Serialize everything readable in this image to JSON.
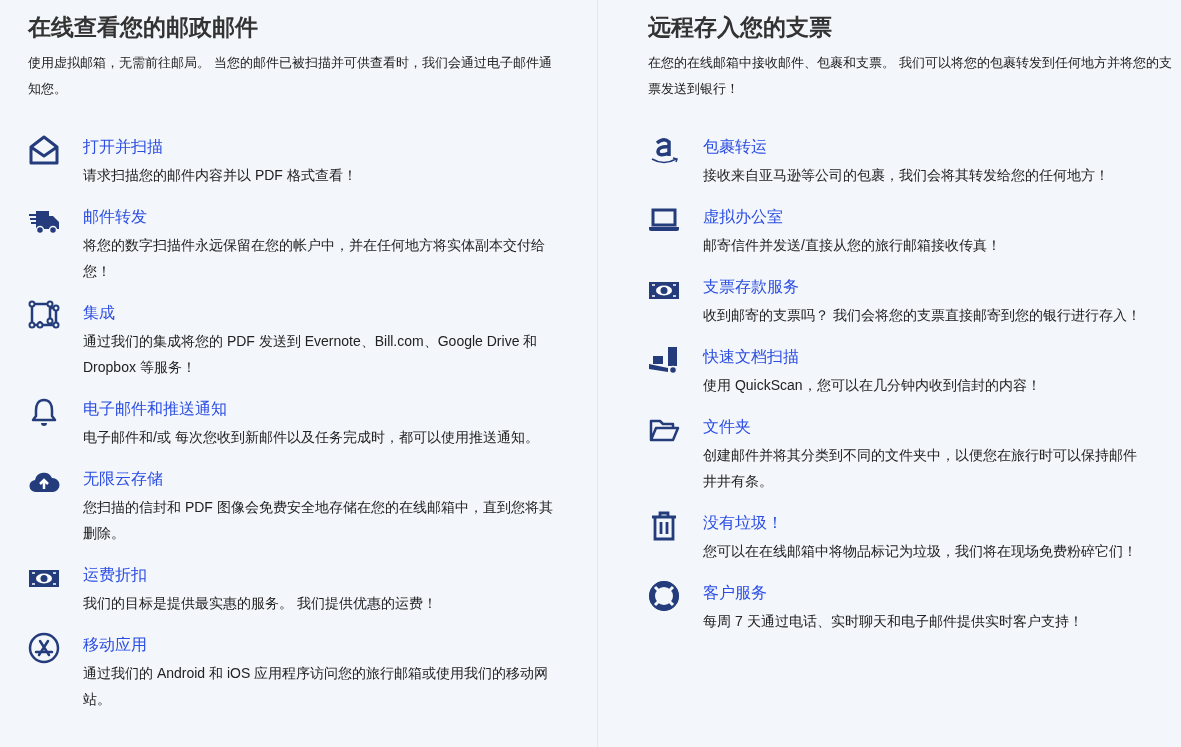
{
  "sections": [
    {
      "heading": "在线查看您的邮政邮件",
      "intro": "使用虚拟邮箱，无需前往邮局。 当您的邮件已被扫描并可供查看时，我们会通过电子邮件通知您。",
      "features": [
        {
          "title": "打开并扫描",
          "description": "请求扫描您的邮件内容并以 PDF 格式查看！"
        },
        {
          "title": "邮件转发",
          "description": "将您的数字扫描件永远保留在您的帐户中，并在任何地方将实体副本交付给您！"
        },
        {
          "title": "集成",
          "description": "通过我们的集成将您的 PDF 发送到 Evernote、Bill.com、Google Drive 和 Dropbox 等服务！"
        },
        {
          "title": "电子邮件和推送通知",
          "description": "电子邮件和/或 每次您收到新邮件以及任务完成时，都可以使用推送通知。"
        },
        {
          "title": "无限云存储",
          "description": "您扫描的信封和 PDF 图像会免费安全地存储在您的在线邮箱中，直到您将其删除。"
        },
        {
          "title": "运费折扣",
          "description": "我们的目标是提供最实惠的服务。 我们提供优惠的运费！"
        },
        {
          "title": "移动应用",
          "description": "通过我们的 Android 和 iOS 应用程序访问您的旅行邮箱或使用我们的移动网站。"
        }
      ]
    },
    {
      "heading": "远程存入您的支票",
      "intro": "在您的在线邮箱中接收邮件、包裹和支票。 我们可以将您的包裹转发到任何地方并将您的支票发送到银行！",
      "features": [
        {
          "title": "包裹转运",
          "description": "接收来自亚马逊等公司的包裹，我们会将其转发给您的任何地方！"
        },
        {
          "title": "虚拟办公室",
          "description": "邮寄信件并发送/直接从您的旅行邮箱接收传真！"
        },
        {
          "title": "支票存款服务",
          "description": "收到邮寄的支票吗？ 我们会将您的支票直接邮寄到您的银行进行存入！"
        },
        {
          "title": "快速文档扫描",
          "description": "使用 QuickScan，您可以在几分钟内收到信封的内容！"
        },
        {
          "title": "文件夹",
          "description": "创建邮件并将其分类到不同的文件夹中，以便您在旅行时可以保持邮件井井有条。"
        },
        {
          "title": "没有垃圾！",
          "description": "您可以在在线邮箱中将物品标记为垃圾，我们将在现场免费粉碎它们！"
        },
        {
          "title": "客户服务",
          "description": "每周 7 天通过电话、实时聊天和电子邮件提供实时客户支持！"
        }
      ]
    }
  ]
}
